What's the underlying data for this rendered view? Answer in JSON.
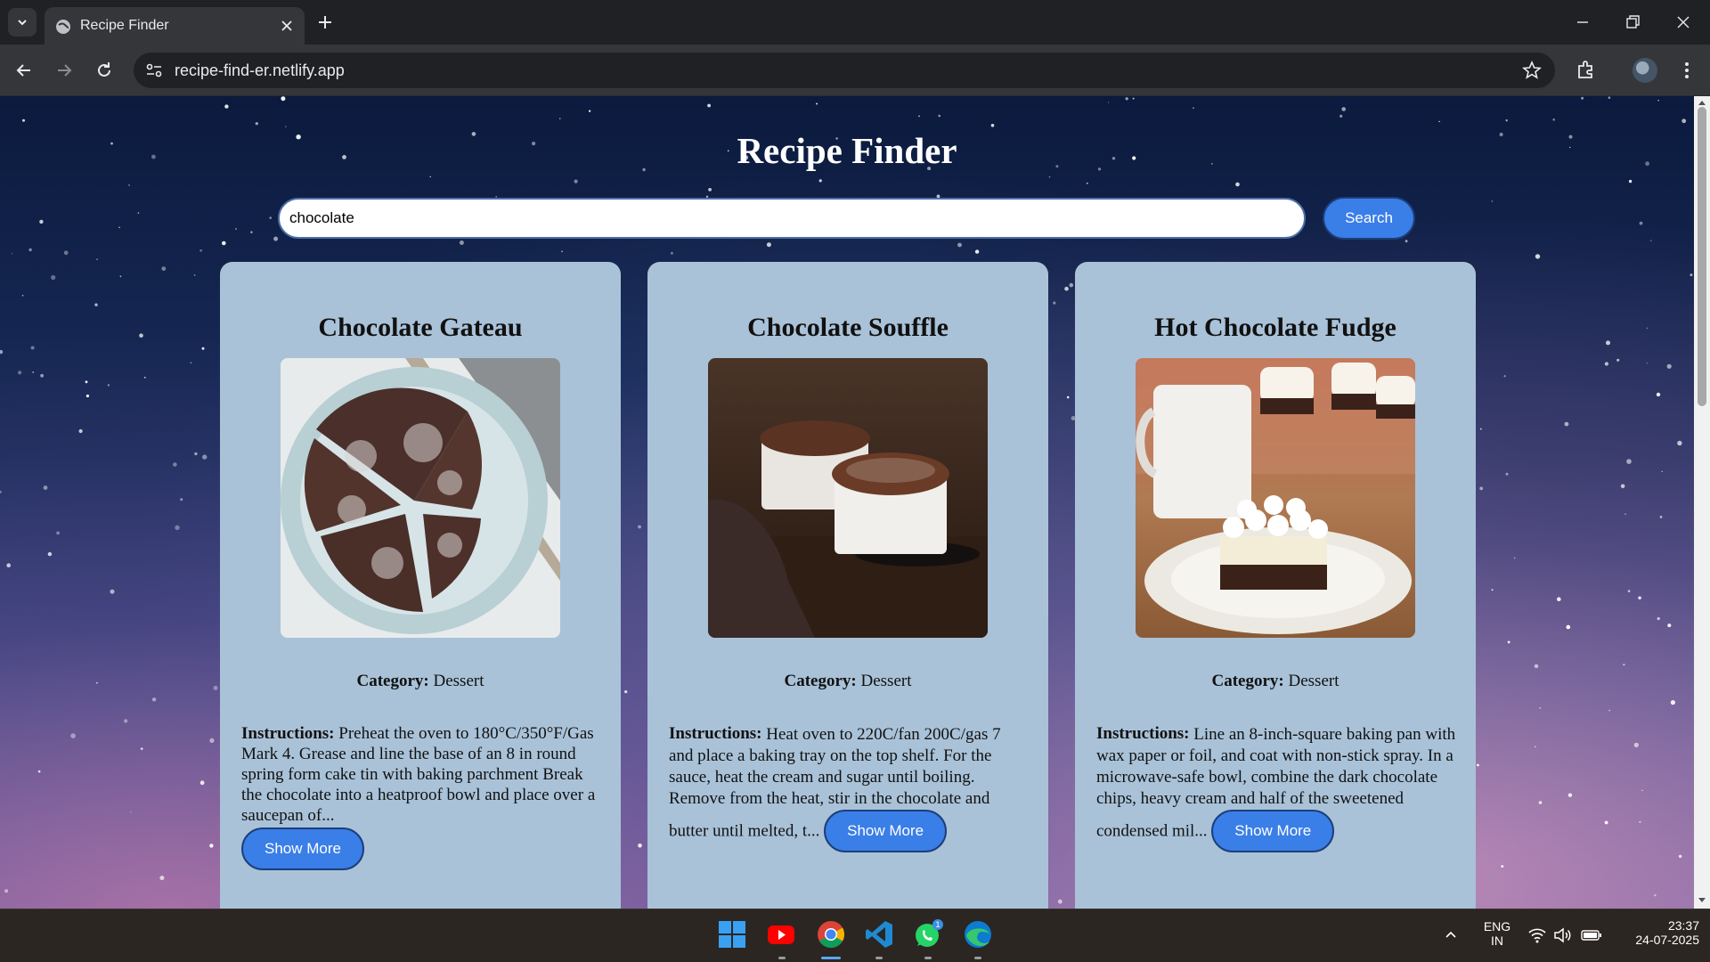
{
  "browser": {
    "tab_title": "Recipe Finder",
    "url": "recipe-find-er.netlify.app"
  },
  "page": {
    "title": "Recipe Finder",
    "search": {
      "value": "chocolate",
      "button_label": "Search"
    },
    "recipes": [
      {
        "title": "Chocolate Gateau",
        "category_label": "Category:",
        "category": "Dessert",
        "instructions_label": "Instructions:",
        "instructions": "Preheat the oven to 180°C/350°F/Gas Mark 4. Grease and line the base of an 8 in round spring form cake tin with baking parchment Break the chocolate into a heatproof bowl and place over a saucepan of...",
        "button_label": "Show More"
      },
      {
        "title": "Chocolate Souffle",
        "category_label": "Category:",
        "category": "Dessert",
        "instructions_label": "Instructions:",
        "instructions": "Heat oven to 220C/fan 200C/gas 7 and place a baking tray on the top shelf. For the sauce, heat the cream and sugar until boiling. Remove from the heat, stir in the chocolate and butter until melted, t...",
        "button_label": "Show More"
      },
      {
        "title": "Hot Chocolate Fudge",
        "category_label": "Category:",
        "category": "Dessert",
        "instructions_label": "Instructions:",
        "instructions": "Line an 8-inch-square baking pan with wax paper or foil, and coat with non-stick spray. In a microwave-safe bowl, combine the dark chocolate chips, heavy cream and half of the sweetened condensed mil...",
        "button_label": "Show More"
      }
    ]
  },
  "taskbar": {
    "apps": [
      "windows-start-icon",
      "youtube-icon",
      "chrome-icon",
      "vscode-icon",
      "whatsapp-icon",
      "edge-icon"
    ],
    "whatsapp_badge": "1",
    "language": "ENG",
    "region": "IN",
    "time": "23:37",
    "date": "24-07-2025"
  },
  "colors": {
    "card_bg": "#a9c2d8",
    "button_bg": "#3a7ee8",
    "chrome_dark": "#202124",
    "chrome_toolbar": "#35363a"
  }
}
